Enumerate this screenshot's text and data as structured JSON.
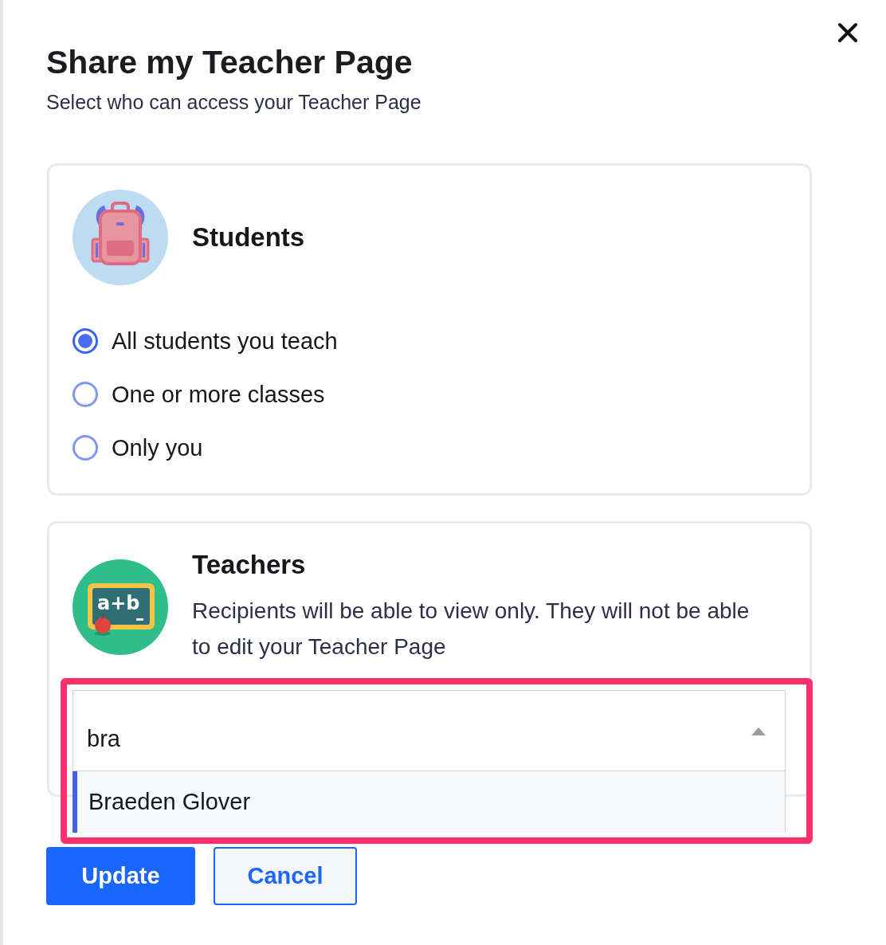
{
  "dialog": {
    "title": "Share my Teacher Page",
    "subtitle": "Select who can access your Teacher Page"
  },
  "students": {
    "heading": "Students",
    "options": [
      {
        "label": "All students you teach",
        "selected": true
      },
      {
        "label": "One or more classes",
        "selected": false
      },
      {
        "label": "Only you",
        "selected": false
      }
    ]
  },
  "teachers": {
    "heading": "Teachers",
    "board_text": "a+b",
    "description": "Recipients will be able to view only. They will not be able to edit your Teacher Page",
    "recipient_search": {
      "value": "bra",
      "expanded": true,
      "highlighted": true,
      "suggestions": [
        {
          "label": "Braeden Glover",
          "selected": true
        }
      ]
    }
  },
  "buttons": [
    {
      "label": "Update",
      "kind": "primary"
    },
    {
      "label": "Cancel",
      "kind": "secondary"
    }
  ]
}
